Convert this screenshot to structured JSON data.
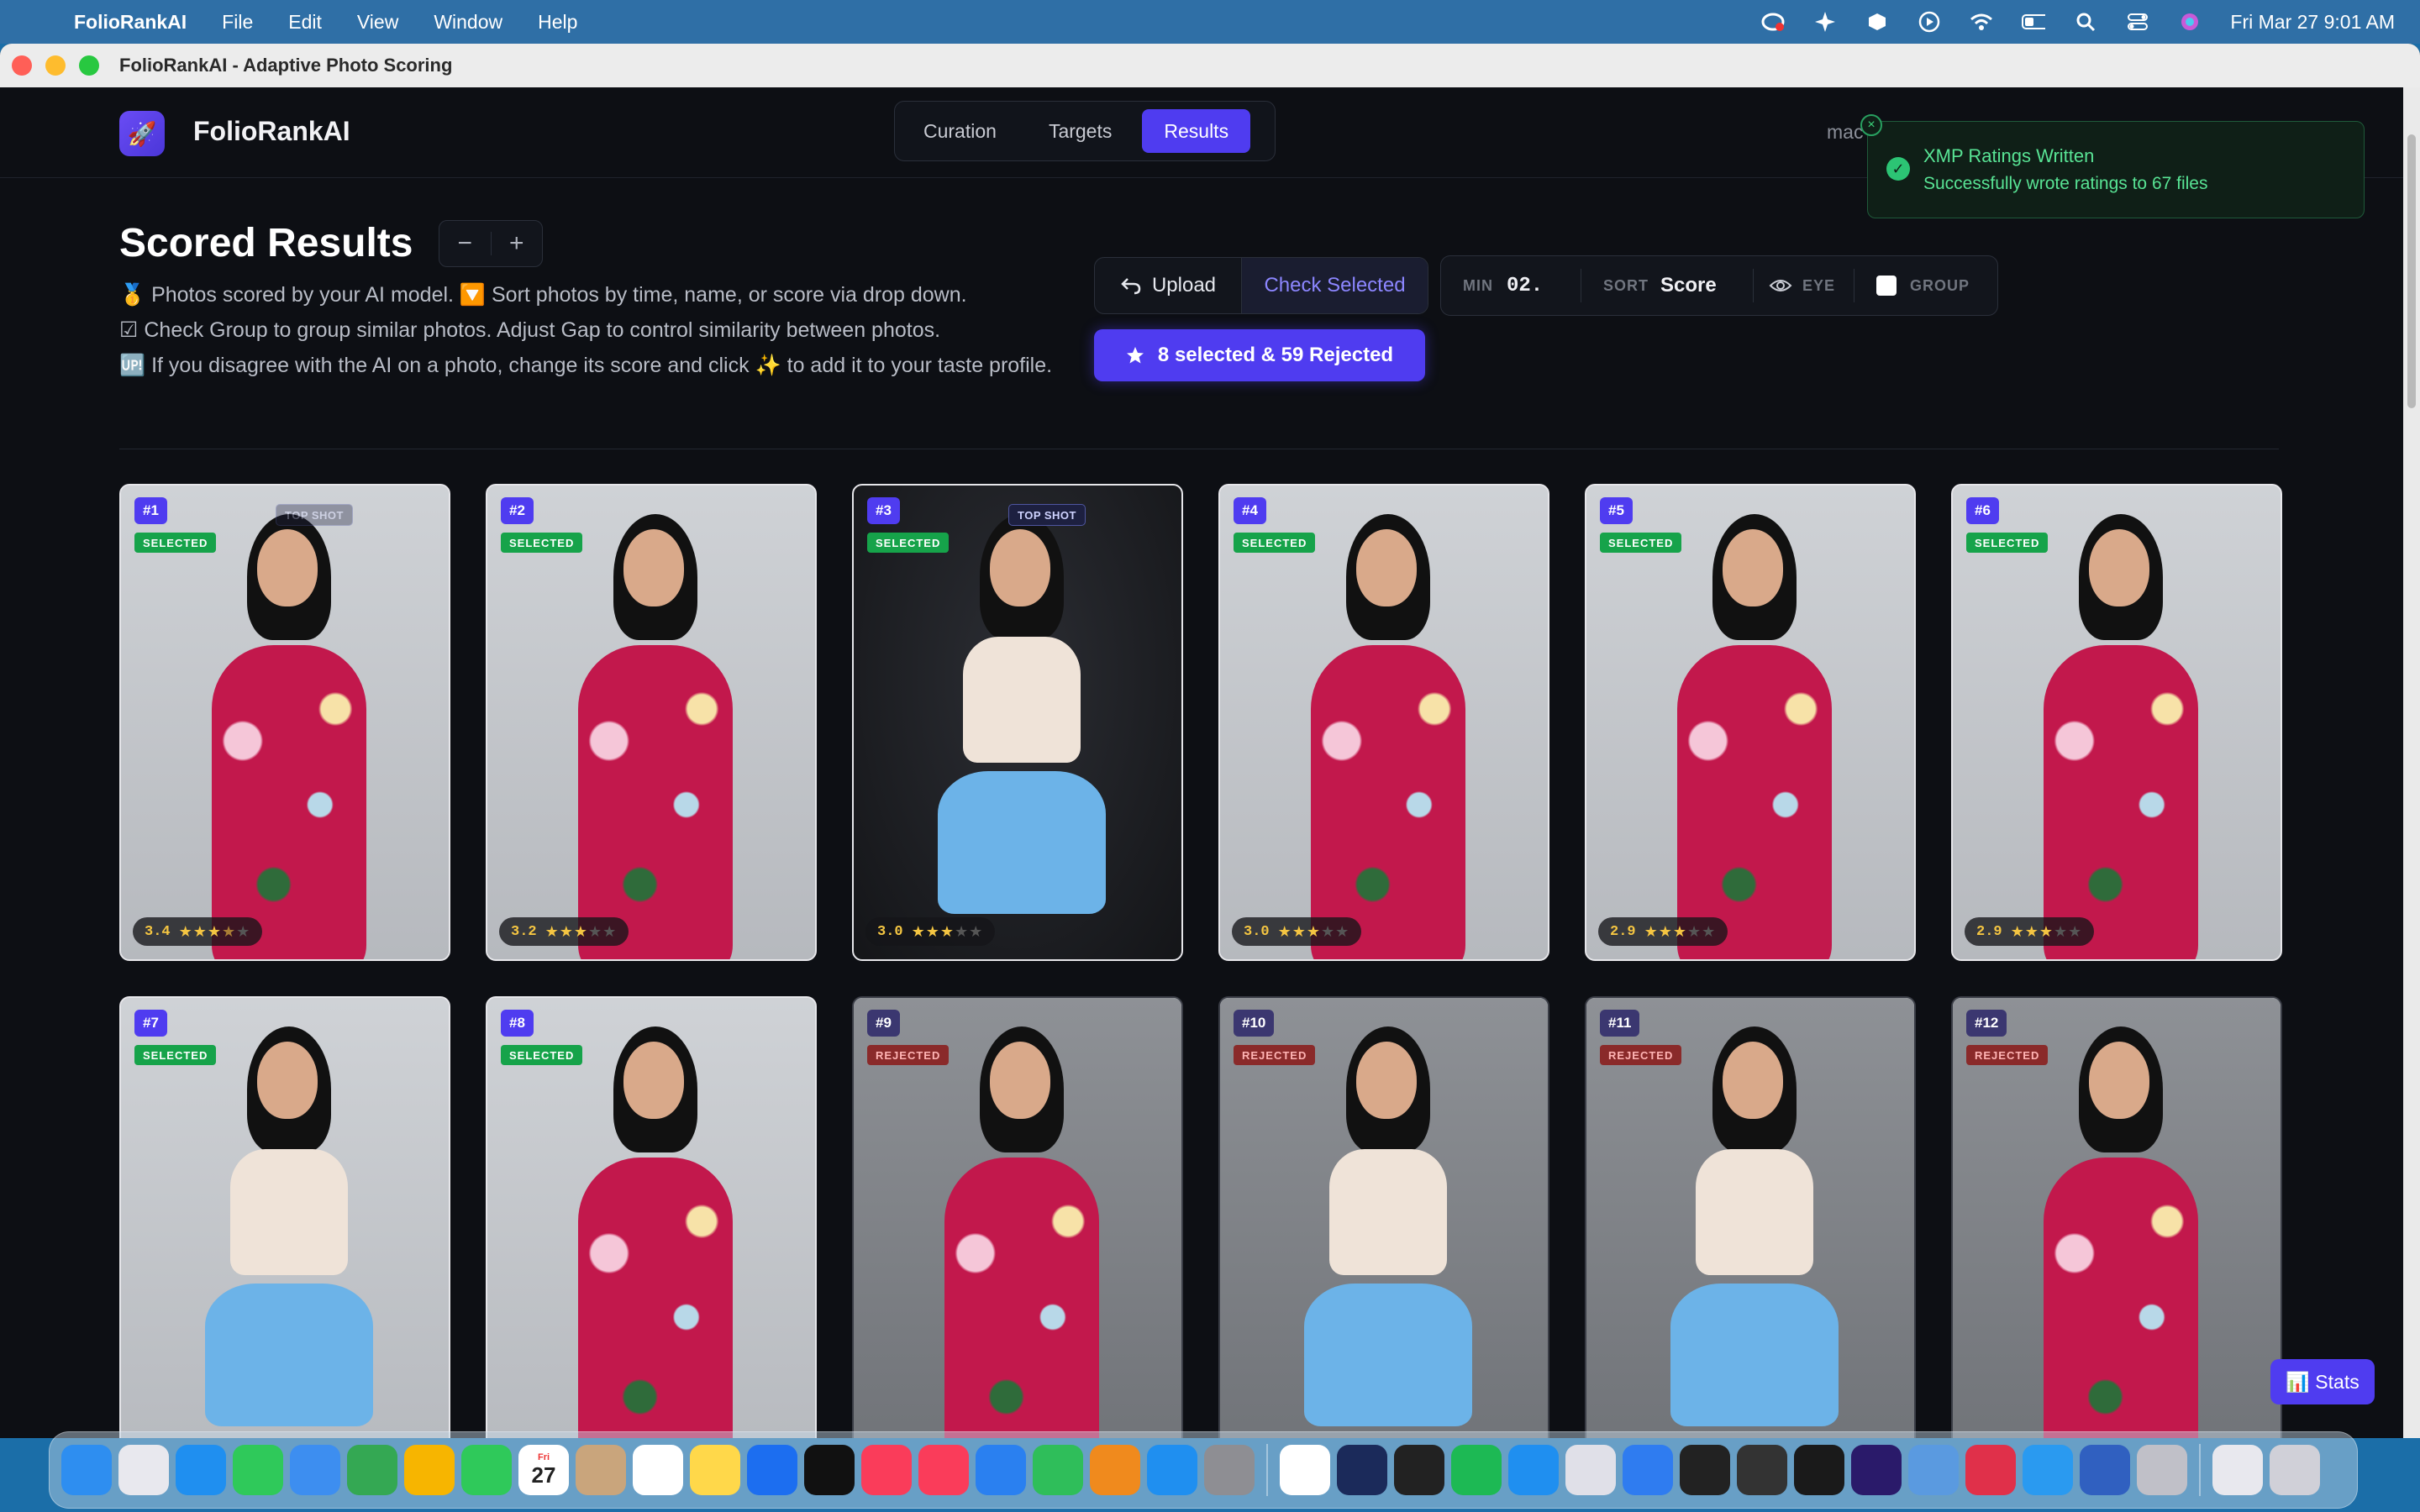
{
  "menubar": {
    "app": "FolioRankAI",
    "menus": [
      "File",
      "Edit",
      "View",
      "Window",
      "Help"
    ],
    "datetime": "Fri Mar 27  9:01 AM"
  },
  "window": {
    "title": "FolioRankAI - Adaptive Photo Scoring"
  },
  "header": {
    "brand": "FolioRankAI",
    "tabs": [
      "Curation",
      "Targets",
      "Results"
    ],
    "active_tab": "Results",
    "user_fragment": "mac"
  },
  "toast": {
    "title": "XMP Ratings Written",
    "message": "Successfully wrote ratings to 67 files",
    "close": "×"
  },
  "results": {
    "title": "Scored Results",
    "zoom_out": "−",
    "zoom_in": "+",
    "desc_1": "🥇 Photos scored by your AI model. 🔽 Sort photos by time, name, or score via drop down.",
    "desc_2": "☑ Check Group to group similar photos. Adjust Gap to control similarity between photos.",
    "desc_3": "🆙 If you disagree with the AI on a photo, change its score and click ✨ to add it to your taste profile."
  },
  "toolbar": {
    "upload": "Upload",
    "check_selected": "Check Selected",
    "min_label": "MIN",
    "min_value": "02.",
    "sort_label": "SORT",
    "sort_value": "Score",
    "eye_label": "EYE",
    "group_label": "GROUP",
    "selection_summary": "8 selected & 59 Rejected"
  },
  "cards": [
    {
      "num": "#1",
      "status": "SELECTED",
      "score": "3.4",
      "stars": 3.5,
      "top_shot": "TOP SHOT",
      "top_shot_faded": true,
      "outfit": "dress"
    },
    {
      "num": "#2",
      "status": "SELECTED",
      "score": "3.2",
      "stars": 3,
      "outfit": "dress"
    },
    {
      "num": "#3",
      "status": "SELECTED",
      "score": "3.0",
      "stars": 3,
      "top_shot": "TOP SHOT",
      "outfit": "tennis",
      "dark": true
    },
    {
      "num": "#4",
      "status": "SELECTED",
      "score": "3.0",
      "stars": 3,
      "outfit": "dress"
    },
    {
      "num": "#5",
      "status": "SELECTED",
      "score": "2.9",
      "stars": 3,
      "outfit": "dress"
    },
    {
      "num": "#6",
      "status": "SELECTED",
      "score": "2.9",
      "stars": 3,
      "outfit": "dress"
    },
    {
      "num": "#7",
      "status": "SELECTED",
      "outfit": "tennis"
    },
    {
      "num": "#8",
      "status": "SELECTED",
      "outfit": "dress"
    },
    {
      "num": "#9",
      "status": "REJECTED",
      "outfit": "dress"
    },
    {
      "num": "#10",
      "status": "REJECTED",
      "outfit": "tennis"
    },
    {
      "num": "#11",
      "status": "REJECTED",
      "outfit": "tennis"
    },
    {
      "num": "#12",
      "status": "REJECTED",
      "outfit": "dress"
    }
  ],
  "stats_button": "📊 Stats",
  "dock_apps": [
    "finder-icon",
    "launchpad-icon",
    "safari-icon",
    "messages-icon",
    "mail-icon",
    "maps-icon",
    "photos-icon",
    "facetime-icon",
    "calendar-icon",
    "contacts-icon",
    "reminders-icon",
    "notes-icon",
    "freeform-icon",
    "tv-icon",
    "music-icon",
    "news-icon",
    "keynote-icon",
    "numbers-icon",
    "pages-icon",
    "appstore-icon",
    "settings-icon",
    "chrome-icon",
    "affinity-icon",
    "terminal-icon",
    "spotify-icon",
    "xcode-icon",
    "chatgpt-icon",
    "files-icon",
    "cube-icon",
    "orb-icon",
    "activity-monitor-icon",
    "premiere-icon",
    "disk-icon",
    "creative-cloud-icon",
    "qq-icon",
    "hammer-icon",
    "foliorank-icon",
    "preview-icon",
    "trash-icon"
  ],
  "dock_calendar": {
    "month": "Fri",
    "day": "27"
  }
}
